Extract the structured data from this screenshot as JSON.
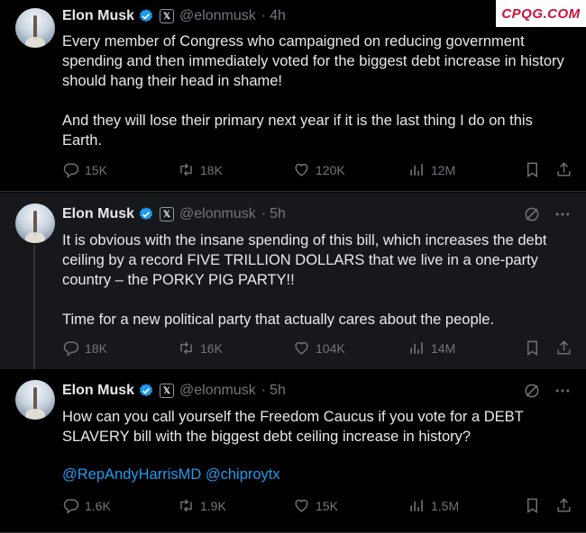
{
  "watermark": "CPQG.COM",
  "tweets": [
    {
      "name": "Elon Musk",
      "handle": "@elonmusk",
      "time": "4h",
      "text": "Every member of Congress who campaigned on reducing government spending and then immediately voted for the biggest debt increase in history should hang their head in shame!\n\nAnd they will lose their primary next year if it is the last thing I do on this Earth.",
      "replies": "15K",
      "reposts": "18K",
      "likes": "120K",
      "views": "12M"
    },
    {
      "name": "Elon Musk",
      "handle": "@elonmusk",
      "time": "5h",
      "text": "It is obvious with the insane spending of this bill, which increases the debt ceiling by a record FIVE TRILLION DOLLARS that we live in a one-party country – the PORKY PIG PARTY!!\n\nTime for a new political party that actually cares about the people.",
      "replies": "18K",
      "reposts": "16K",
      "likes": "104K",
      "views": "14M"
    },
    {
      "name": "Elon Musk",
      "handle": "@elonmusk",
      "time": "5h",
      "text": "How can you call yourself the Freedom Caucus if you vote for a DEBT SLAVERY bill with the biggest debt ceiling increase in history?",
      "mentions": "@RepAndyHarrisMD @chiproytx",
      "replies": "1.6K",
      "reposts": "1.9K",
      "likes": "15K",
      "views": "1.5M"
    }
  ],
  "colors": {
    "verified": "#1d9bf0",
    "link": "#1d9bf0",
    "muted": "#71767b",
    "watermark": "#d0103a"
  }
}
